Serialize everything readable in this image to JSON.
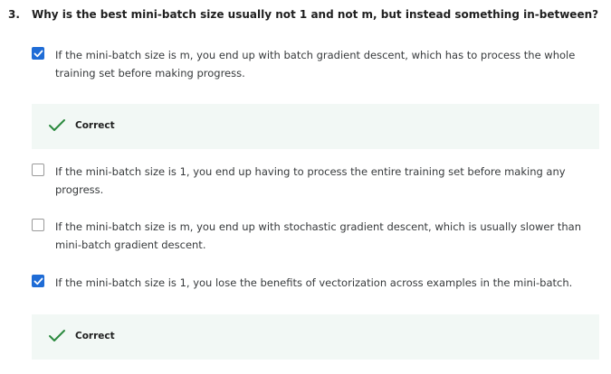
{
  "question": {
    "number": "3.",
    "text": "Why is the best mini-batch size usually not 1 and not m, but instead something in-between?"
  },
  "options": [
    {
      "text": "If the mini-batch size is m, you end up with batch gradient descent, which has to process the whole training set before making progress.",
      "checked": true,
      "feedback": "Correct"
    },
    {
      "text": "If the mini-batch size is 1, you end up having to process the entire training set before making any progress.",
      "checked": false
    },
    {
      "text": "If the mini-batch size is m, you end up with stochastic gradient descent, which is usually slower than mini-batch gradient descent.",
      "checked": false
    },
    {
      "text": "If the mini-batch size is 1, you lose the benefits of vectorization across examples in the mini-batch.",
      "checked": true,
      "feedback": "Correct"
    }
  ],
  "colors": {
    "checkbox_checked": "#1f6cd6",
    "correct_check": "#2b8a3e",
    "feedback_bg": "#f2f8f5"
  }
}
